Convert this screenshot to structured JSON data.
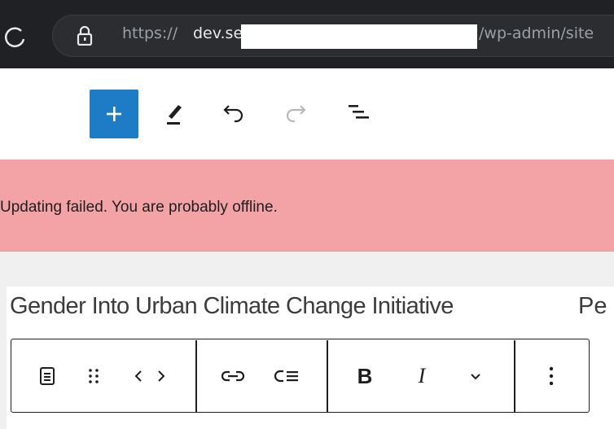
{
  "browser": {
    "url_scheme": "https://",
    "url_host": "dev.se",
    "url_path": "/wp-admin/site"
  },
  "editor_toolbar": {
    "add_label": "+",
    "icons": [
      "plus-icon",
      "pen-icon",
      "undo-icon",
      "redo-icon",
      "document-outline-icon"
    ]
  },
  "notice": {
    "message": "Updating failed. You are probably offline."
  },
  "block": {
    "heading": "Gender Into Urban Climate Change Initiative",
    "heading_tail": "Pe"
  },
  "block_toolbar": {
    "bold_label": "B",
    "italic_label": "I",
    "icons": [
      "paragraph-icon",
      "drag-handle-icon",
      "move-arrows-icon",
      "link-icon",
      "indent-icon",
      "chevron-down-icon",
      "more-options-icon"
    ]
  },
  "colors": {
    "browser_bar": "#202124",
    "accent_blue": "#1e7cc6",
    "error_notice": "#f3a3a6",
    "canvas": "#f0f0f0"
  }
}
